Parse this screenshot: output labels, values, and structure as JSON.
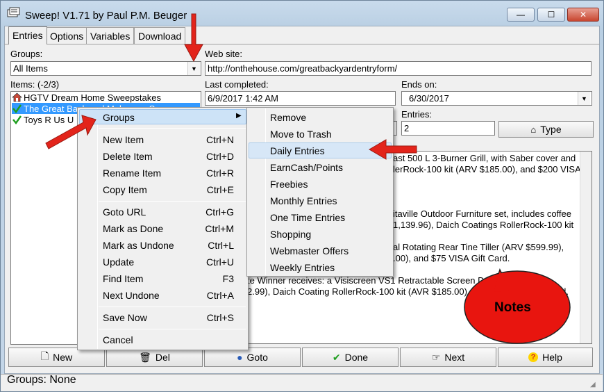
{
  "window": {
    "title": "Sweep! V1.71 by Paul P.M. Beuger",
    "controls": {
      "minimize": "—",
      "maximize": "☐",
      "close": "✕"
    }
  },
  "tabs": [
    {
      "label": "Entries",
      "active": true
    },
    {
      "label": "Options"
    },
    {
      "label": "Variables"
    },
    {
      "label": "Download"
    }
  ],
  "groups": {
    "label": "Groups:",
    "value": "All Items"
  },
  "website": {
    "label": "Web site:",
    "value": "http://onthehouse.com/greatbackyardentryform/"
  },
  "items": {
    "label": "Items: (-2/3)",
    "rows": [
      {
        "icon": "house-icon",
        "text": "HGTV Dream Home Sweepstakes",
        "selected": false
      },
      {
        "icon": "checkmark-icon",
        "text": "The Great Backyard Makeover Sweeps",
        "selected": true
      },
      {
        "icon": "checkmark-icon",
        "text": "Toys R Us U",
        "selected": false
      }
    ]
  },
  "last_completed": {
    "label": "Last completed:",
    "value": "6/9/2017 1:42 AM"
  },
  "ends_on": {
    "label": "Ends on:",
    "value": "6/30/2017"
  },
  "entries": {
    "label": "Entries:",
    "value": "2"
  },
  "type_button": "Type",
  "notes_text": [
    "ast 500 L 3-Burner Grill, with Saber cover and",
    "lerRock-100 kit (ARV $185.00), and $200 VISA",
    "itaville Outdoor Furniture set, includes coffee",
    "1,139.96), Daich Coatings RollerRock-100 kit",
    "al Rotating Rear Tine Tiller (ARV $599.99),",
    ".00), and $75 VISA Gift Card.",
    "te Winner receives: a Visiscreen VS1 Retractable Screen Door (482x84?)",
    "2.99), Daich Coating RollerRock-100 kit (AVR $185.00), and $50 VISA Gift Card."
  ],
  "bottom_buttons": [
    {
      "label": "New",
      "icon": "page-icon"
    },
    {
      "label": "Del",
      "icon": "trash-icon"
    },
    {
      "label": "Goto",
      "icon": "globe-icon"
    },
    {
      "label": "Done",
      "icon": "checkmark-icon"
    },
    {
      "label": "Next",
      "icon": "pointing-hand-icon"
    },
    {
      "label": "Help",
      "icon": "question-icon"
    }
  ],
  "status": "Groups: None",
  "context_menu": {
    "groups": "Groups",
    "items": [
      {
        "label": "New Item",
        "shortcut": "Ctrl+N"
      },
      {
        "label": "Delete Item",
        "shortcut": "Ctrl+D"
      },
      {
        "label": "Rename Item",
        "shortcut": "Ctrl+R"
      },
      {
        "label": "Copy Item",
        "shortcut": "Ctrl+E"
      },
      {
        "label": "Goto URL",
        "shortcut": "Ctrl+G"
      },
      {
        "label": "Mark as Done",
        "shortcut": "Ctrl+M"
      },
      {
        "label": "Mark as Undone",
        "shortcut": "Ctrl+L"
      },
      {
        "label": "Update",
        "shortcut": "Ctrl+U"
      },
      {
        "label": "Find Item",
        "shortcut": "F3"
      },
      {
        "label": "Next Undone",
        "shortcut": "Ctrl+A"
      },
      {
        "label": "Save Now",
        "shortcut": "Ctrl+S"
      },
      {
        "label": "Cancel",
        "shortcut": ""
      }
    ]
  },
  "submenu": [
    "Remove",
    "Move to Trash",
    "Daily Entries",
    "EarnCash/Points",
    "Freebies",
    "Monthly Entries",
    "One Time Entries",
    "Shopping",
    "Webmaster Offers",
    "Weekly Entries"
  ],
  "callout": {
    "label": "Notes",
    "color": "#e8150f"
  },
  "annotation_arrow_color": "#e3241b"
}
